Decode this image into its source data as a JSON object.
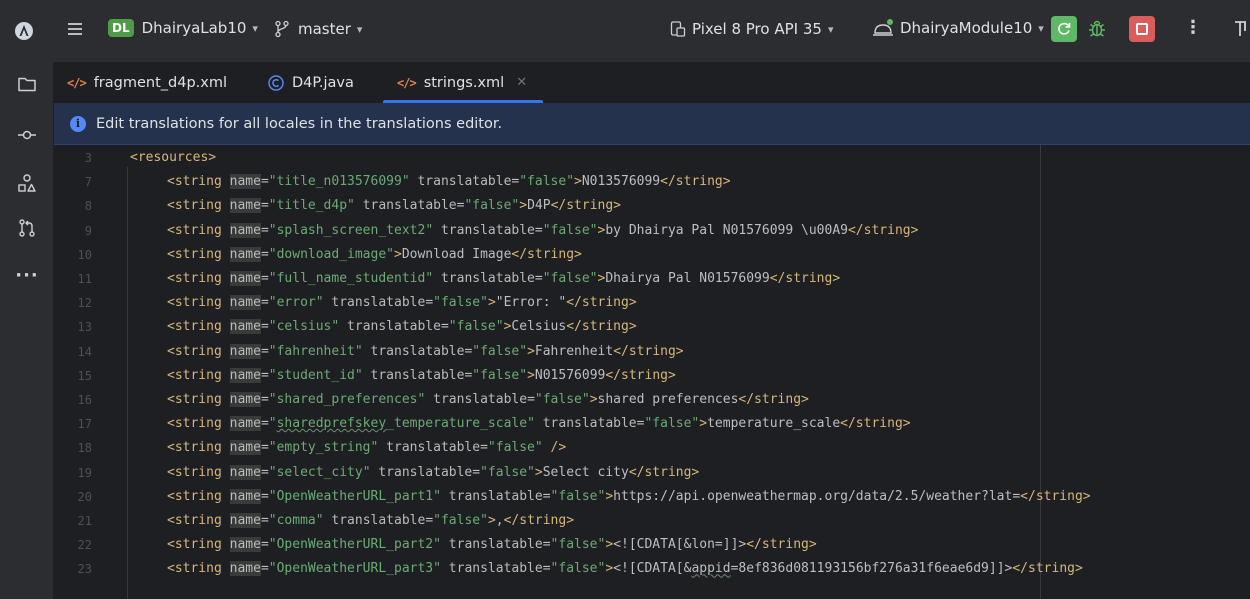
{
  "toolbar": {
    "project_badge": "DL",
    "project_name": "DhairyaLab10",
    "branch": "master",
    "device": "Pixel 8 Pro API 35",
    "module": "DhairyaModule10"
  },
  "tabs": [
    {
      "label": "fragment_d4p.xml",
      "icon": "xml-file-icon"
    },
    {
      "label": "D4P.java",
      "icon": "java-class-icon"
    },
    {
      "label": "strings.xml",
      "icon": "xml-file-icon",
      "active": true
    }
  ],
  "banner": {
    "text": "Edit translations for all locales in the translations editor."
  },
  "editor": {
    "lines": [
      {
        "n": "3",
        "tag": "<resources>"
      },
      {
        "n": "7",
        "name": "title_n013576099",
        "translatable": "false",
        "content": "N013576099"
      },
      {
        "n": "8",
        "name": "title_d4p",
        "translatable": "false",
        "content": "D4P"
      },
      {
        "n": "9",
        "name": "splash_screen_text2",
        "translatable": "false",
        "content": "by Dhairya Pal N01576099 \\u00A9"
      },
      {
        "n": "10",
        "name": "download_image",
        "content": "Download Image"
      },
      {
        "n": "11",
        "name": "full_name_studentid",
        "translatable": "false",
        "content": "Dhairya Pal N01576099"
      },
      {
        "n": "12",
        "name": "error",
        "translatable": "false",
        "content": "\"Error: \""
      },
      {
        "n": "13",
        "name": "celsius",
        "translatable": "false",
        "content": "Celsius"
      },
      {
        "n": "14",
        "name": "fahrenheit",
        "translatable": "false",
        "content": "Fahrenheit"
      },
      {
        "n": "15",
        "name": "student_id",
        "translatable": "false",
        "content": "N01576099"
      },
      {
        "n": "16",
        "name": "shared_preferences",
        "translatable": "false",
        "content": "shared preferences"
      },
      {
        "n": "17",
        "name": "sharedprefskey_temperature_scale",
        "translatable": "false",
        "content": "temperature_scale"
      },
      {
        "n": "18",
        "name": "empty_string",
        "translatable": "false",
        "selfclose": true
      },
      {
        "n": "19",
        "name": "select_city",
        "translatable": "false",
        "content": "Select city"
      },
      {
        "n": "20",
        "name": "OpenWeatherURL_part1",
        "translatable": "false",
        "content": "https://api.openweathermap.org/data/2.5/weather?lat="
      },
      {
        "n": "21",
        "name": "comma",
        "translatable": "false",
        "content": ","
      },
      {
        "n": "22",
        "name": "OpenWeatherURL_part2",
        "translatable": "false",
        "content": "<![CDATA[&lon=]]>"
      },
      {
        "n": "23",
        "name": "OpenWeatherURL_part3",
        "translatable": "false",
        "content": "<![CDATA[&appid=8ef836d081193156bf276a31f6eae6d9]]>"
      }
    ]
  },
  "colors": {
    "accent": "#3574f0",
    "run_green": "#5fb865",
    "stop_red": "#db5c5c",
    "tag": "#d5b778",
    "string_value": "#6aab73"
  }
}
